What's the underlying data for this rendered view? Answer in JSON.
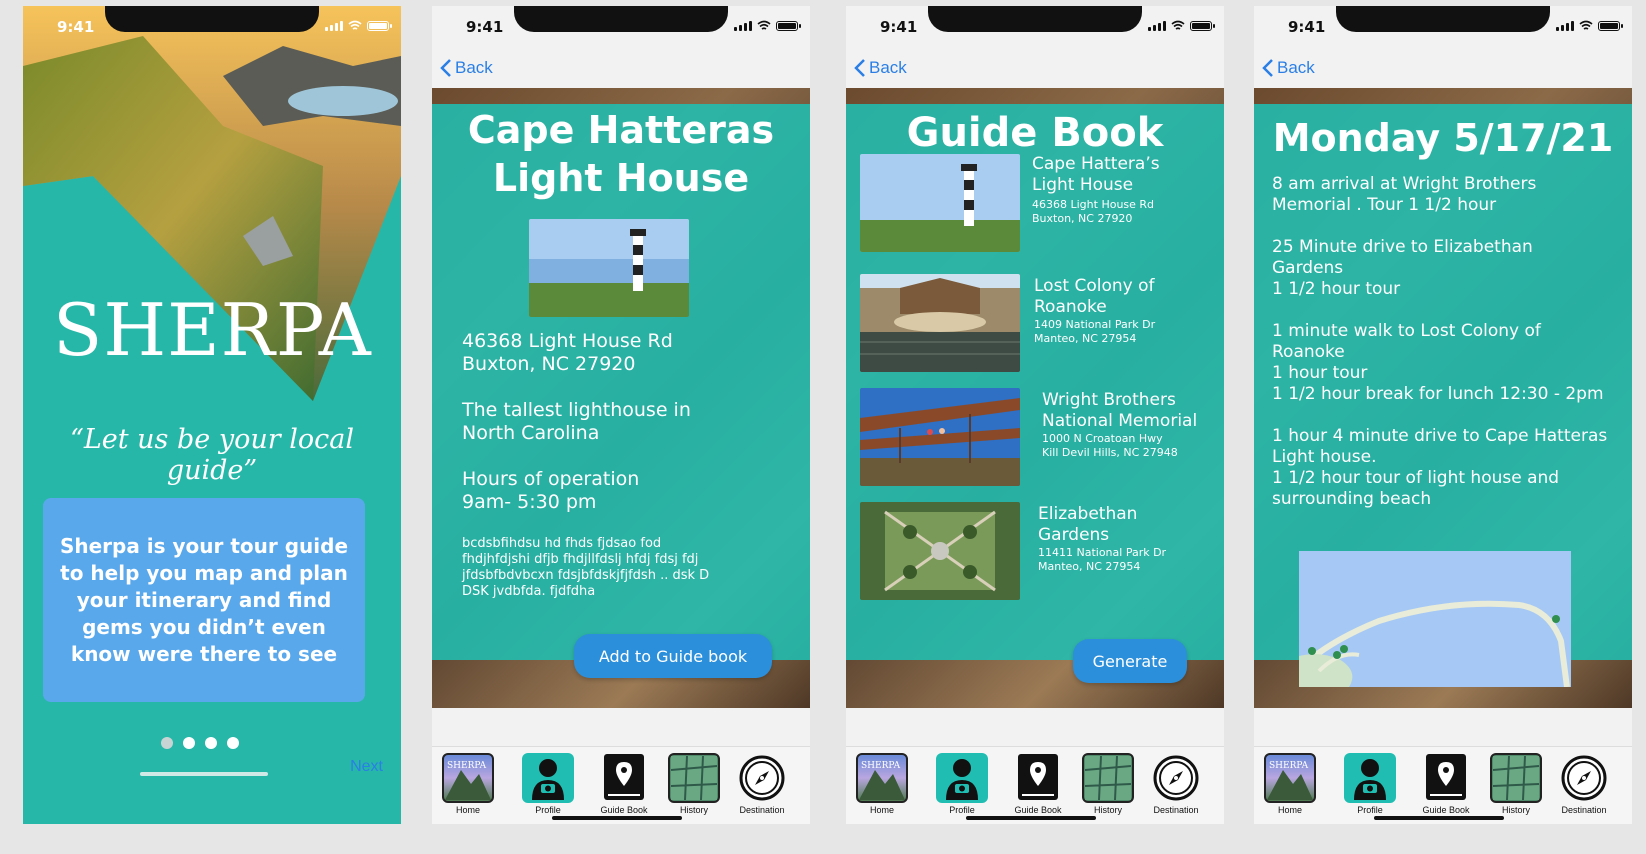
{
  "status": {
    "time": "9:41"
  },
  "nav": {
    "back": "Back"
  },
  "tabs": [
    {
      "label": "Home",
      "icon": "mountain-logo-icon"
    },
    {
      "label": "Profile",
      "icon": "person-camera-icon"
    },
    {
      "label": "Guide Book",
      "icon": "map-pin-icon"
    },
    {
      "label": "History",
      "icon": "folded-map-icon"
    },
    {
      "label": "Destination",
      "icon": "compass-icon"
    }
  ],
  "onboarding": {
    "logo": "SHERPA",
    "tagline": "“Let us be your local guide”",
    "description": "Sherpa is your tour guide to help you map and plan your itinerary and find gems you didn’t even know were there to see",
    "page_count": 4,
    "current_page": 1,
    "next": "Next"
  },
  "detail": {
    "title_line1": "Cape Hatteras",
    "title_line2": "Light House",
    "address_line1": "46368 Light House Rd",
    "address_line2": "Buxton, NC 27920",
    "fact_line1": "The tallest lighthouse in",
    "fact_line2": "North Carolina",
    "hours_label": "Hours of operation",
    "hours_value": "9am- 5:30 pm",
    "notes_line1": "bcdsbfihdsu hd  fhds  fjdsao fod",
    "notes_line2": "fhdjhfdjshi dfjb  fhdjllfdslj  hfdj  fdsj fdj",
    "notes_line3": "jfdsbfbdvbcxn  fdsjbfdskjfjfdsh .. dsk D",
    "notes_line4": "DSK jvdbfda. fjdfdha",
    "button": "Add to Guide book"
  },
  "guidebook": {
    "title": "Guide Book",
    "items": [
      {
        "name1": "Cape Hattera’s",
        "name2": "Light House",
        "addr1": "46368 Light House Rd",
        "addr2": "Buxton, NC 27920"
      },
      {
        "name1": "Lost Colony of",
        "name2": "Roanoke",
        "addr1": "1409 National Park Dr",
        "addr2": "Manteo, NC 27954"
      },
      {
        "name1": "Wright Brothers",
        "name2": "National Memorial",
        "addr1": "1000 N Croatoan Hwy",
        "addr2": "Kill Devil Hills, NC 27948"
      },
      {
        "name1": "Elizabethan",
        "name2": "Gardens",
        "addr1": "11411 National Park Dr",
        "addr2": "Manteo, NC 27954"
      }
    ],
    "button": "Generate"
  },
  "itinerary": {
    "title": "Monday 5/17/21",
    "paragraphs": [
      "8 am arrival at Wright Brothers\nMemorial . Tour 1 1/2 hour",
      "25 Minute drive to Elizabethan\nGardens\n1 1/2 hour tour",
      "1 minute walk to Lost Colony of\nRoanoke\n1 hour tour\n1 1/2 hour  break for lunch 12:30 - 2pm",
      "1 hour 4 minute drive to Cape Hatteras\nLight house.\n1 1/2 hour tour of light house and\nsurrounding beach"
    ]
  },
  "colors": {
    "teal": "#20beb2",
    "blue_button": "#2b8fdc",
    "link_blue": "#2a7fe6",
    "card_blue": "#5aa8ec"
  }
}
